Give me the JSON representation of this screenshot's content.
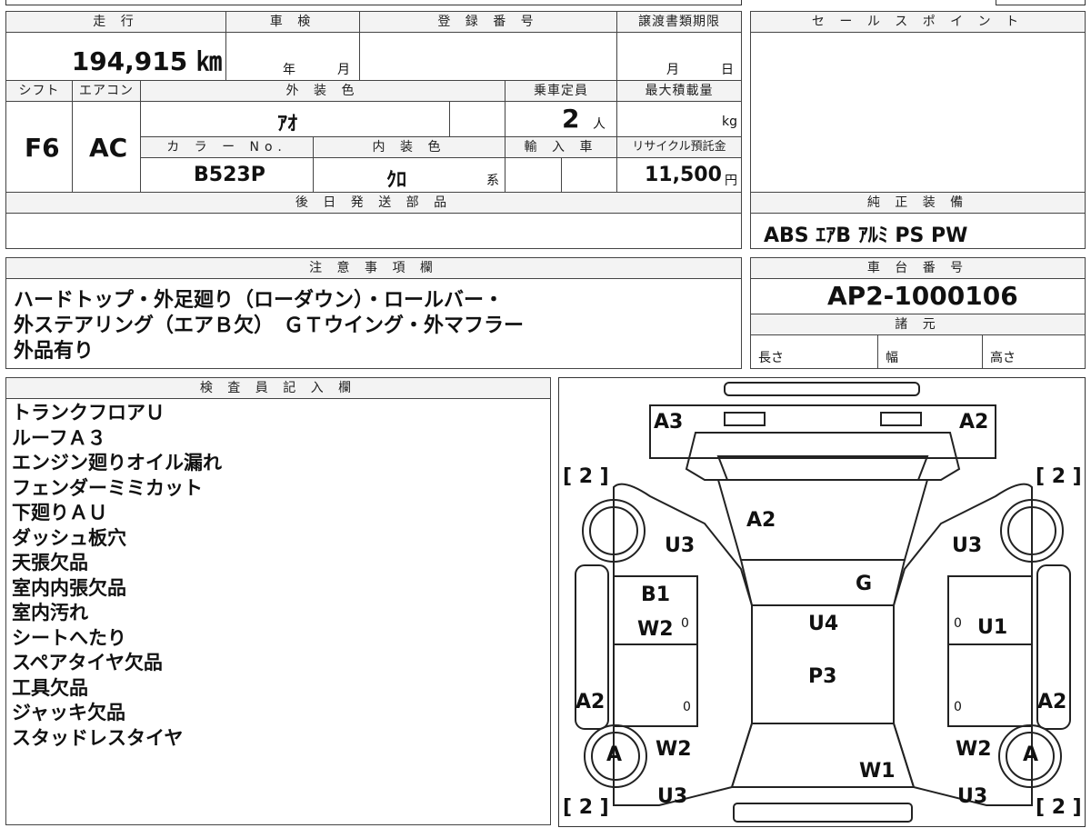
{
  "header": {
    "mileage_label": "走 行",
    "inspection_label": "車 検",
    "registration_label": "登 録 番 号",
    "transfer_label": "譲渡書類期限",
    "salespoint_label": "セ ー ル ス ポ イ ン ト",
    "mileage_value": "194,915 ㎞",
    "inspection_year": "年",
    "inspection_month": "月",
    "transfer_month": "月",
    "transfer_day": "日"
  },
  "specs": {
    "shift_label": "シフト",
    "aircon_label": "エアコン",
    "exterior_label": "外 装 色",
    "capacity_label": "乗車定員",
    "maxload_label": "最大積載量",
    "shift_value": "F6",
    "aircon_value": "AC",
    "exterior_value": "ｱｵ",
    "capacity_value": "2",
    "capacity_unit": "人",
    "maxload_unit": "kg",
    "color_no_label": "カ ラ ー No.",
    "interior_label": "内 装 色",
    "import_label": "輸 入 車",
    "recycle_label": "リサイクル預託金",
    "color_no_value": "B523P",
    "interior_value": "ｸﾛ",
    "interior_suffix": "系",
    "recycle_value": "11,500",
    "recycle_unit": "円",
    "later_parts_label": "後 日 発 送 部 品",
    "genuine_label": "純 正 装 備",
    "genuine_value": "ABS ｴｱB ｱﾙﾐ PS PW"
  },
  "notes": {
    "label": "注 意 事 項 欄",
    "lines": [
      "ハードトップ・外足廻り（ローダウン）・ロールバー・",
      "外ステアリング（エアＢ欠）　ＧＴウイング・外マフラー",
      "外品有り"
    ]
  },
  "chassis": {
    "label": "車 台 番 号",
    "value": "AP2-1000106",
    "specs_label": "諸 元",
    "length_label": "長さ",
    "width_label": "幅",
    "height_label": "高さ"
  },
  "inspector": {
    "label": "検 査 員 記 入 欄",
    "items": [
      "トランクフロアＵ",
      "ルーフＡ３",
      "エンジン廻りオイル漏れ",
      "フェンダーミミカット",
      "下廻りＡＵ",
      "ダッシュ板穴",
      "天張欠品",
      "室内内張欠品",
      "室内汚れ",
      "シートへたり",
      "スペアタイヤ欠品",
      "工具欠品",
      "ジャッキ欠品",
      "スタッドレスタイヤ"
    ]
  },
  "diagram": {
    "labels": {
      "rear_left": "A3",
      "rear_right": "A2",
      "trunk": "A2",
      "left_rear_quarter": "U3",
      "right_rear_quarter": "U3",
      "roof": "G",
      "left_rear_door": "B1",
      "left_door_w": "W2",
      "roof_center": "U4",
      "right_rear_door": "U1",
      "hood_p": "P3",
      "left_sill": "A2",
      "right_sill": "A2",
      "left_front": "W2",
      "right_front": "W2",
      "windshield": "W1",
      "left_front_u": "U3",
      "right_front_u": "U3",
      "wheel_left": "A",
      "wheel_right": "A",
      "bracket_tl": "[ 2 ]",
      "bracket_tr": "[ 2 ]",
      "bracket_bl": "[ 2 ]",
      "bracket_br": "[ 2 ]",
      "zero": "0"
    }
  }
}
